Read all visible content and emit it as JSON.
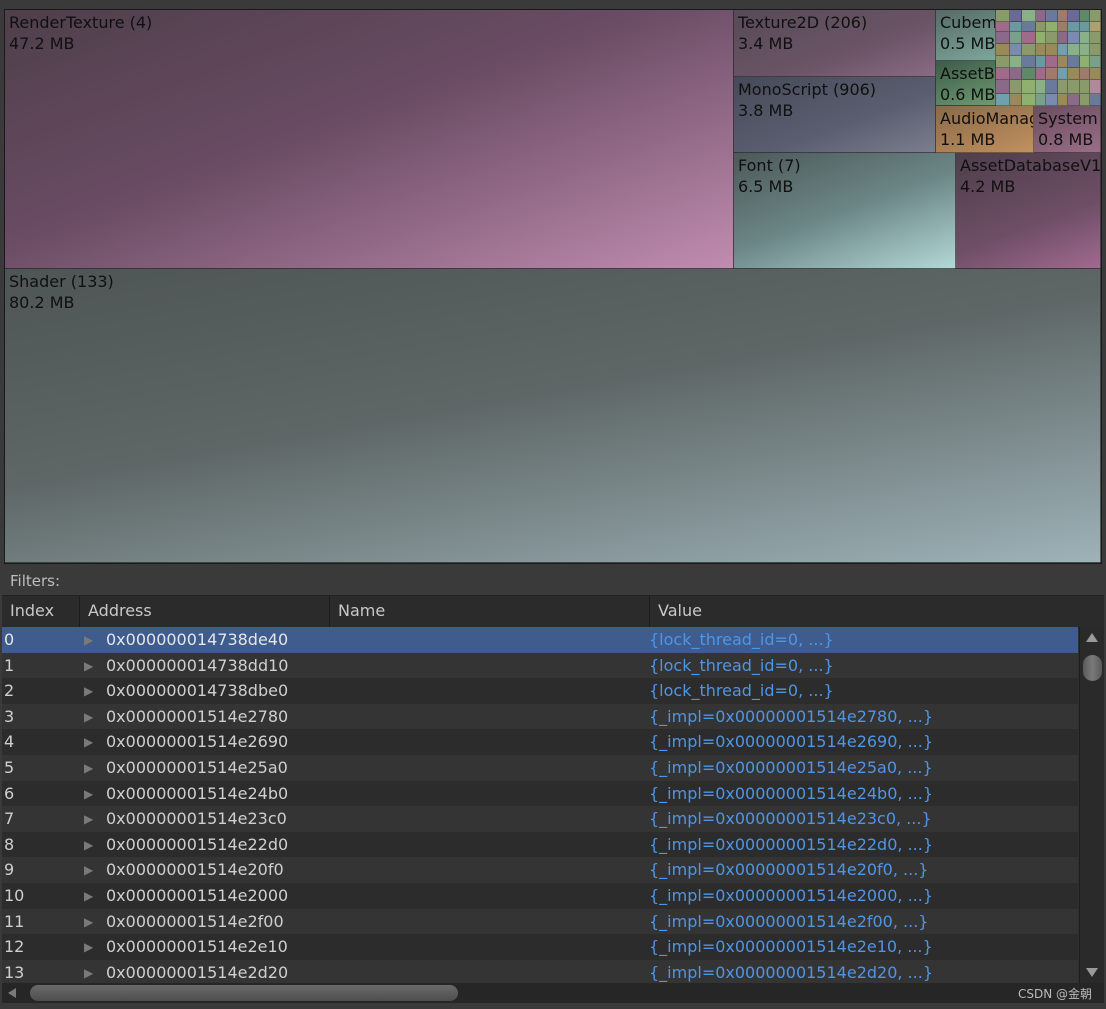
{
  "treemap": {
    "cells": [
      {
        "key": "render",
        "name": "RenderTexture (4)",
        "size": "47.2 MB"
      },
      {
        "key": "shader",
        "name": "Shader (133)",
        "size": "80.2 MB"
      },
      {
        "key": "tex2d",
        "name": "Texture2D (206)",
        "size": "3.4 MB"
      },
      {
        "key": "mono",
        "name": "MonoScript (906)",
        "size": "3.8 MB"
      },
      {
        "key": "font",
        "name": "Font (7)",
        "size": "6.5 MB"
      },
      {
        "key": "assetdb",
        "name": "AssetDatabaseV1",
        "size": "4.2 MB"
      },
      {
        "key": "cubemap",
        "name": "Cubemap",
        "size": "0.5 MB"
      },
      {
        "key": "assetb",
        "name": "AssetBundle",
        "size": "0.6 MB"
      },
      {
        "key": "audio",
        "name": "AudioManager",
        "size": "1.1 MB"
      },
      {
        "key": "system",
        "name": "System",
        "size": "0.8 MB"
      }
    ]
  },
  "filters_label": "Filters:",
  "table": {
    "columns": [
      "Index",
      "Address",
      "Name",
      "Value"
    ],
    "selected_index": 0,
    "rows": [
      {
        "index": "0",
        "address": "0x000000014738de40",
        "name": "",
        "value": "{lock_thread_id=0, ...}"
      },
      {
        "index": "1",
        "address": "0x000000014738dd10",
        "name": "",
        "value": "{lock_thread_id=0, ...}"
      },
      {
        "index": "2",
        "address": "0x000000014738dbe0",
        "name": "",
        "value": "{lock_thread_id=0, ...}"
      },
      {
        "index": "3",
        "address": "0x00000001514e2780",
        "name": "",
        "value": "{_impl=0x00000001514e2780, ...}"
      },
      {
        "index": "4",
        "address": "0x00000001514e2690",
        "name": "",
        "value": "{_impl=0x00000001514e2690, ...}"
      },
      {
        "index": "5",
        "address": "0x00000001514e25a0",
        "name": "",
        "value": "{_impl=0x00000001514e25a0, ...}"
      },
      {
        "index": "6",
        "address": "0x00000001514e24b0",
        "name": "",
        "value": "{_impl=0x00000001514e24b0, ...}"
      },
      {
        "index": "7",
        "address": "0x00000001514e23c0",
        "name": "",
        "value": "{_impl=0x00000001514e23c0, ...}"
      },
      {
        "index": "8",
        "address": "0x00000001514e22d0",
        "name": "",
        "value": "{_impl=0x00000001514e22d0, ...}"
      },
      {
        "index": "9",
        "address": "0x00000001514e20f0",
        "name": "",
        "value": "{_impl=0x00000001514e20f0, ...}"
      },
      {
        "index": "10",
        "address": "0x00000001514e2000",
        "name": "",
        "value": "{_impl=0x00000001514e2000, ...}"
      },
      {
        "index": "11",
        "address": "0x00000001514e2f00",
        "name": "",
        "value": "{_impl=0x00000001514e2f00, ...}"
      },
      {
        "index": "12",
        "address": "0x00000001514e2e10",
        "name": "",
        "value": "{_impl=0x00000001514e2e10, ...}"
      },
      {
        "index": "13",
        "address": "0x00000001514e2d20",
        "name": "",
        "value": "{_impl=0x00000001514e2d20, ...}"
      }
    ]
  },
  "watermark": "CSDN @金朝",
  "colors": {
    "selection": "#3f5c8f",
    "value_link": "#4f95e6",
    "background": "#3a3a3a"
  }
}
